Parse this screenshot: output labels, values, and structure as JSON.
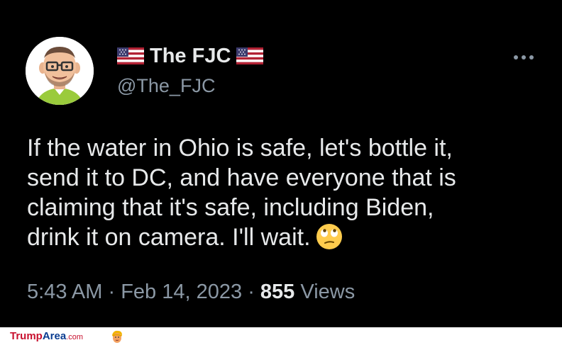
{
  "tweet": {
    "display_name": "The FJC",
    "handle": "@The_FJC",
    "flag_icon": "us-flag-icon",
    "more_icon": "ellipsis-icon",
    "text_lines": [
      "If the water in Ohio is safe, let's bottle it,",
      "send it to DC, and have everyone that is",
      "claiming that it's safe, including Biden,",
      "drink it on camera.  I'll wait."
    ],
    "emoji": "face-with-rolling-eyes-emoji",
    "time": "5:43 AM",
    "separator": "·",
    "date": "Feb 14, 2023",
    "views_count": "855",
    "views_label": "Views"
  },
  "footer": {
    "brand_part1": "Trump",
    "brand_part2": "Area",
    "brand_suffix": ".com",
    "logo_icon": "trump-face-icon"
  },
  "colors": {
    "background": "#000000",
    "primary_text": "#e7e9ea",
    "secondary_text": "#8b98a5",
    "brand_red": "#c8102e",
    "brand_blue": "#0b3d91"
  }
}
